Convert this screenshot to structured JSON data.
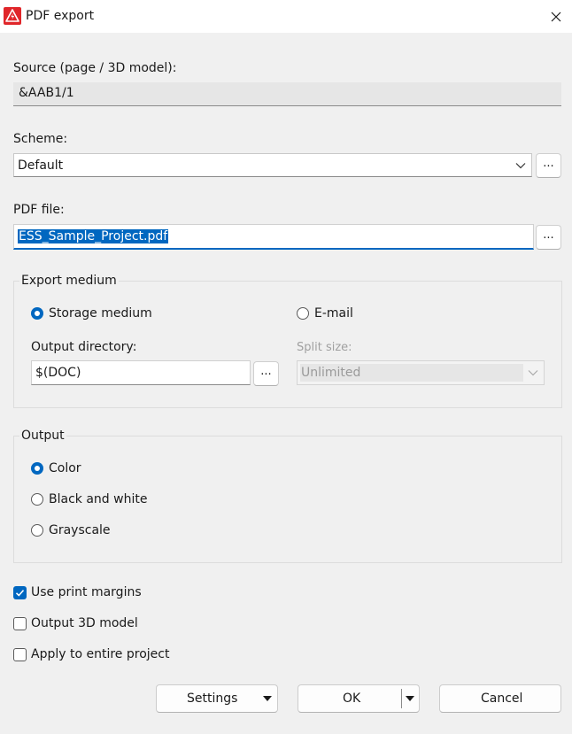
{
  "window": {
    "title": "PDF export"
  },
  "icons": {
    "app": "warning-triangle-icon",
    "close": "close-icon"
  },
  "source": {
    "label": "Source (page / 3D model):",
    "value": "&AAB1/1"
  },
  "scheme": {
    "label": "Scheme:",
    "value": "Default",
    "more_label": "..."
  },
  "pdf_file": {
    "label": "PDF file:",
    "value": "ESS_Sample_Project.pdf",
    "more_label": "..."
  },
  "export_medium": {
    "title": "Export medium",
    "storage_label": "Storage medium",
    "storage_checked": true,
    "email_label": "E-mail",
    "email_checked": false,
    "output_dir_label": "Output directory:",
    "output_dir_value": "$(DOC)",
    "output_dir_more": "...",
    "split_size_label": "Split size:",
    "split_size_value": "Unlimited"
  },
  "output": {
    "title": "Output",
    "options": [
      {
        "label": "Color",
        "checked": true
      },
      {
        "label": "Black and white",
        "checked": false
      },
      {
        "label": "Grayscale",
        "checked": false
      }
    ]
  },
  "checkboxes": [
    {
      "label": "Use print margins",
      "checked": true
    },
    {
      "label": "Output 3D model",
      "checked": false
    },
    {
      "label": "Apply to entire project",
      "checked": false
    }
  ],
  "buttons": {
    "settings": "Settings",
    "ok": "OK",
    "cancel": "Cancel"
  },
  "colors": {
    "accent": "#0067c0",
    "app_icon": "#e0262a"
  }
}
